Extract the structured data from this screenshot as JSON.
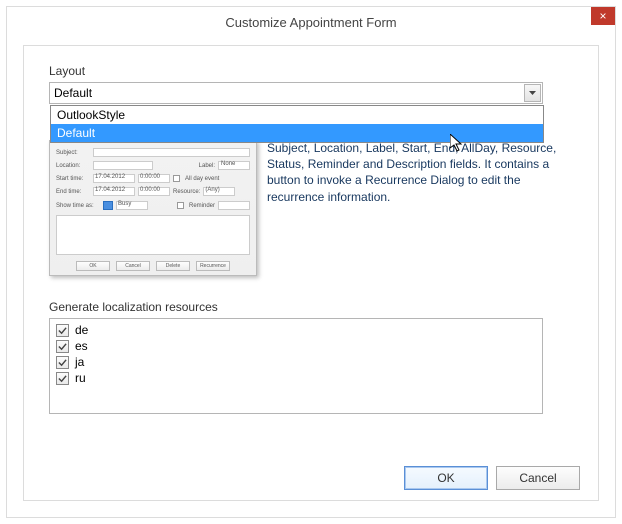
{
  "window": {
    "title": "Customize Appointment Form",
    "close_label": "×"
  },
  "layout": {
    "label": "Layout",
    "value": "Default",
    "options": [
      "OutlookStyle",
      "Default"
    ],
    "selected_index": 1
  },
  "description": "Subject, Location, Label, Start, End, AllDay, Resource, Status, Reminder and Description fields. It contains a button to invoke a Recurrence Dialog to edit the recurrence information.",
  "preview": {
    "subject_label": "Subject:",
    "location_label": "Location:",
    "label_label": "Label:",
    "label_value": "None",
    "start_label": "Start time:",
    "end_label": "End time:",
    "date_value": "17.04.2012",
    "start_time_value": "0:00:00",
    "end_time_value": "0:00:00",
    "allday_label": "All day event",
    "resource_label": "Resource:",
    "resource_value": "(Any)",
    "showtime_label": "Show time as:",
    "showtime_value": "Busy",
    "reminder_label": "Reminder",
    "buttons": [
      "OK",
      "Cancel",
      "Delete",
      "Recurrence"
    ]
  },
  "localization": {
    "label": "Generate localization resources",
    "items": [
      {
        "code": "de",
        "checked": true
      },
      {
        "code": "es",
        "checked": true
      },
      {
        "code": "ja",
        "checked": true
      },
      {
        "code": "ru",
        "checked": true
      }
    ]
  },
  "buttons": {
    "ok": "OK",
    "cancel": "Cancel"
  }
}
